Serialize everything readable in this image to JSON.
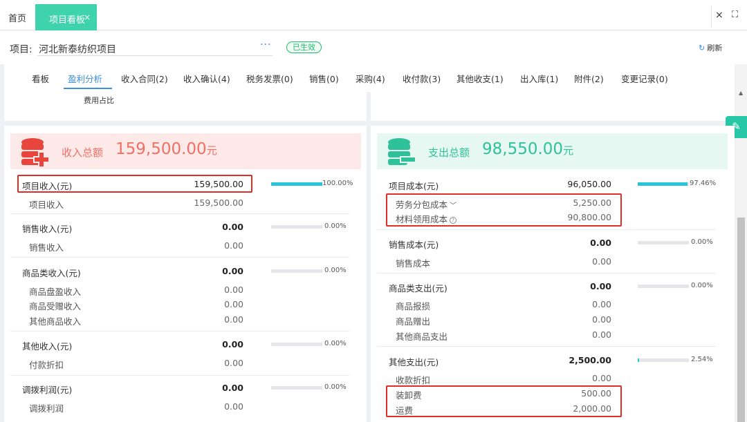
{
  "tabbar": {
    "home": "首页",
    "active_tab": "项目看板",
    "close_tab": "×",
    "close_icon": "×",
    "fullscreen_icon": "⛶"
  },
  "project": {
    "label": "项目:",
    "name": "河北新泰纺织项目",
    "more": "···",
    "status": "已生效",
    "refresh": "刷新"
  },
  "nav": {
    "items": [
      "看板",
      "盈利分析",
      "收入合同(2)",
      "收入确认(4)",
      "税务发票(0)",
      "销售(0)",
      "采购(4)",
      "收付款(3)",
      "其他收支(1)",
      "出入库(1)",
      "附件(2)",
      "变更记录(0)"
    ],
    "active_index": 1,
    "subtab": "费用占比"
  },
  "income": {
    "title": "收入总额",
    "total": "159,500.00",
    "unit": "元",
    "groups": [
      {
        "label": "项目收入(元)",
        "amount": "159,500.00",
        "percent": "100.00%",
        "fraction": 1.0,
        "items": [
          {
            "label": "项目收入",
            "amount": "159,500.00"
          }
        ]
      },
      {
        "label": "销售收入(元)",
        "amount": "0.00",
        "percent": "0.00%",
        "fraction": 0,
        "items": [
          {
            "label": "销售收入",
            "amount": "0.00"
          }
        ]
      },
      {
        "label": "商品类收入(元)",
        "amount": "0.00",
        "percent": "0.00%",
        "fraction": 0,
        "items": [
          {
            "label": "商品盘盈收入",
            "amount": "0.00"
          },
          {
            "label": "商品受赠收入",
            "amount": "0.00"
          },
          {
            "label": "其他商品收入",
            "amount": "0.00"
          }
        ]
      },
      {
        "label": "其他收入(元)",
        "amount": "0.00",
        "percent": "0.00%",
        "fraction": 0,
        "items": [
          {
            "label": "付款折扣",
            "amount": "0.00"
          }
        ]
      },
      {
        "label": "调拨利润(元)",
        "amount": "0.00",
        "percent": "0.00%",
        "fraction": 0,
        "items": [
          {
            "label": "调拨利润",
            "amount": "0.00"
          }
        ]
      }
    ]
  },
  "expense": {
    "title": "支出总额",
    "total": "98,550.00",
    "unit": "元",
    "groups": [
      {
        "label": "项目成本(元)",
        "amount": "96,050.00",
        "percent": "97.46%",
        "fraction": 0.9746,
        "items": [
          {
            "label": "劳务分包成本",
            "amount": "5,250.00"
          },
          {
            "label": "材料领用成本",
            "amount": "90,800.00"
          }
        ]
      },
      {
        "label": "销售成本(元)",
        "amount": "0.00",
        "percent": "0.00%",
        "fraction": 0,
        "items": [
          {
            "label": "销售成本",
            "amount": "0.00"
          }
        ]
      },
      {
        "label": "商品类支出(元)",
        "amount": "0.00",
        "percent": "0.00%",
        "fraction": 0,
        "items": [
          {
            "label": "商品报损",
            "amount": "0.00"
          },
          {
            "label": "商品赠出",
            "amount": "0.00"
          },
          {
            "label": "其他商品支出",
            "amount": "0.00"
          }
        ]
      },
      {
        "label": "其他支出(元)",
        "amount": "2,500.00",
        "percent": "2.54%",
        "fraction": 0.0254,
        "items": [
          {
            "label": "收款折扣",
            "amount": "0.00"
          },
          {
            "label": "装卸费",
            "amount": "500.00"
          },
          {
            "label": "运费",
            "amount": "2,000.00"
          }
        ]
      }
    ]
  },
  "colors": {
    "accent": "#3ed3ac",
    "link": "#3a8ee6",
    "income": "#f07065",
    "expense": "#2fc29a",
    "bar": "#2bc3d8",
    "highlight": "#e02d26"
  }
}
